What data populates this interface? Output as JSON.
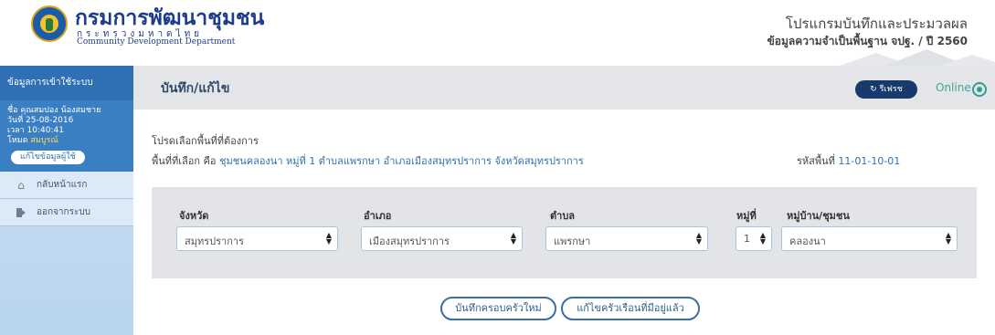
{
  "header": {
    "org_name": "กรมการพัฒนาชุมชน",
    "org_ministry": "กระทรวงมหาดไทย",
    "org_english": "Community Development Department",
    "app_title": "โปรแกรมบันทึกและประมวลผล",
    "app_subtitle": "ข้อมูลความจำเป็นพื้นฐาน จปฐ. / ปี 2560"
  },
  "sidebar": {
    "heading": "ข้อมูลการเข้าใช้ระบบ",
    "user": {
      "name_line": "ชื่อ คุณสมปอง น้องสมชาย",
      "date_line": "วันที่ 25-08-2016",
      "time_line": "เวลา 10:40:41",
      "mode_label": "โหมด",
      "mode_value": "สมบูรณ์",
      "edit_button": "แก้ไขข้อมูลผู้ใช้"
    },
    "items": [
      {
        "label": "กลับหน้าแรก",
        "icon": "home-icon"
      },
      {
        "label": "ออกจากระบบ",
        "icon": "logout-icon"
      }
    ]
  },
  "toolbar": {
    "title": "บันทึก/แก้ไข",
    "refresh_label": "รีเฟรช",
    "status_label": "Online"
  },
  "main": {
    "prompt": "โปรดเลือกพื้นที่ที่ต้องการ",
    "selected_prefix": "พื้นที่ที่เลือก คือ",
    "selected_value": "ชุมชนคลองนา หมู่ที่ 1 ตำบลแพรกษา อำเภอเมืองสมุทรปราการ จังหวัดสมุทรปราการ",
    "area_code_label": "รหัสพื้นที่",
    "area_code_value": "11-01-10-01"
  },
  "filters": {
    "province": {
      "label": "จังหวัด",
      "value": "สมุทรปราการ"
    },
    "district": {
      "label": "อำเภอ",
      "value": "เมืองสมุทรปราการ"
    },
    "subdistrict": {
      "label": "ตำบล",
      "value": "แพรกษา"
    },
    "village_no": {
      "label": "หมู่ที่",
      "value": "1"
    },
    "community": {
      "label": "หมู่บ้าน/ชุมชน",
      "value": "คลองนา"
    }
  },
  "actions": {
    "new_family": "บันทึกครอบครัวใหม่",
    "edit_existing": "แก้ไขครัวเรือนที่มีอยู่แล้ว"
  },
  "colors": {
    "brand_blue": "#2f6fb3",
    "navy": "#17396b",
    "online_teal": "#3aa99a"
  }
}
